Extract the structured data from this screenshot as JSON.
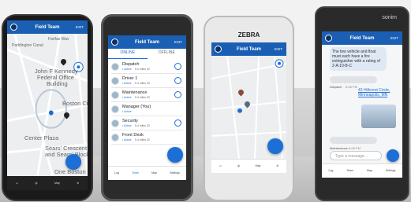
{
  "phone1": {
    "title": "Field Team",
    "exit": "EXIT",
    "map_labels": [
      "Paddington Canal",
      "Fairfax Wav",
      "John F Kennedy",
      "Federal Office",
      "Building",
      "Boston City",
      "Center Plaza",
      "Sears' Crescent",
      "and Sears' Block",
      "One Boston"
    ],
    "nav": [
      "",
      "",
      "Map",
      ""
    ]
  },
  "phone2": {
    "title": "Field Team",
    "exit": "EXIT",
    "tab_online": "ONLINE",
    "tab_offline": "OFFLINE",
    "contacts": [
      {
        "name": "Dispatch",
        "status": "• Active",
        "dist": "5.4 miles 32"
      },
      {
        "name": "Driver 1",
        "status": "• Active",
        "dist": "5.4 miles 32"
      },
      {
        "name": "Maintenance",
        "status": "• Active",
        "dist": "5.4 miles 32"
      },
      {
        "name": "Manager (You)",
        "status": "• Active",
        "dist": ""
      },
      {
        "name": "Security",
        "status": "• Active",
        "dist": "5.4 miles 32"
      },
      {
        "name": "Front Desk",
        "status": "• Active",
        "dist": "5.4 miles 32"
      }
    ],
    "nav": [
      "Log",
      "Team",
      "Map",
      "Settings"
    ]
  },
  "phone3": {
    "brand": "ZEBRA",
    "title": "Field Team",
    "exit": "EXIT",
    "nav": [
      "",
      "",
      "Map",
      ""
    ]
  },
  "phone4": {
    "brand": "sonim",
    "title": "Field Team",
    "exit": "EXIT",
    "message_text": "The tow vehicle and float must each have a fire extinguisher with a rating of 2-A:10-B-C",
    "sender1": "Dispatch",
    "time1": "8:08 PM",
    "address": "43 Hillcrest Circle, Minneapolis, MN",
    "sender2": "Maintenance",
    "time2": "8:08 PM",
    "placeholder": "Type a message...",
    "nav": [
      "Log",
      "Team",
      "Map",
      "Settings"
    ]
  },
  "colors": {
    "header": "#1b5fb5",
    "accent": "#1b6fd6"
  }
}
